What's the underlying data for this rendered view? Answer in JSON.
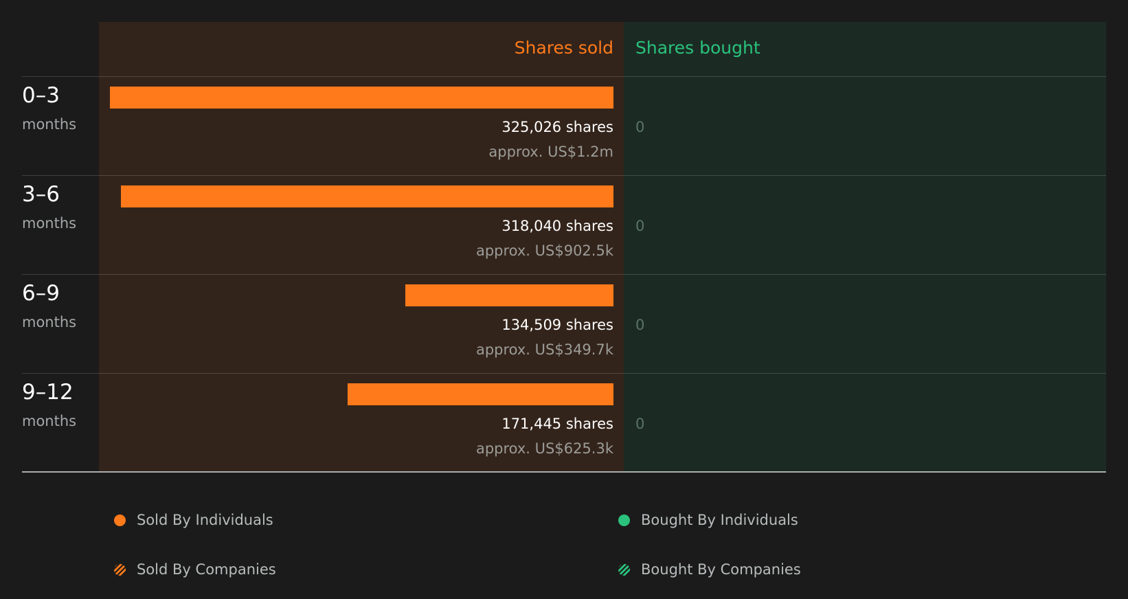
{
  "colors": {
    "sold": "#ff7a1a",
    "bought": "#2ac27c",
    "sold_panel": "#33241b",
    "bought_panel": "#1b2b24"
  },
  "chart_data": {
    "type": "bar",
    "orientation": "horizontal-diverging",
    "headers": {
      "sold": "Shares sold",
      "bought": "Shares bought"
    },
    "max_value": 325026,
    "rows": [
      {
        "period": "0–3",
        "unit": "months",
        "sold_value": 325026,
        "sold_label": "325,026 shares",
        "sold_approx": "approx. US$1.2m",
        "bought_label": "0"
      },
      {
        "period": "3–6",
        "unit": "months",
        "sold_value": 318040,
        "sold_label": "318,040 shares",
        "sold_approx": "approx. US$902.5k",
        "bought_label": "0"
      },
      {
        "period": "6–9",
        "unit": "months",
        "sold_value": 134509,
        "sold_label": "134,509 shares",
        "sold_approx": "approx. US$349.7k",
        "bought_label": "0"
      },
      {
        "period": "9–12",
        "unit": "months",
        "sold_value": 171445,
        "sold_label": "171,445 shares",
        "sold_approx": "approx. US$625.3k",
        "bought_label": "0"
      }
    ],
    "legend": [
      {
        "label": "Sold By Individuals",
        "style": "solid",
        "color": "#ff7a1a"
      },
      {
        "label": "Bought By Individuals",
        "style": "solid",
        "color": "#2ac27c"
      },
      {
        "label": "Sold By Companies",
        "style": "hatched",
        "color": "#ff7a1a"
      },
      {
        "label": "Bought By Companies",
        "style": "hatched",
        "color": "#2ac27c"
      }
    ]
  }
}
